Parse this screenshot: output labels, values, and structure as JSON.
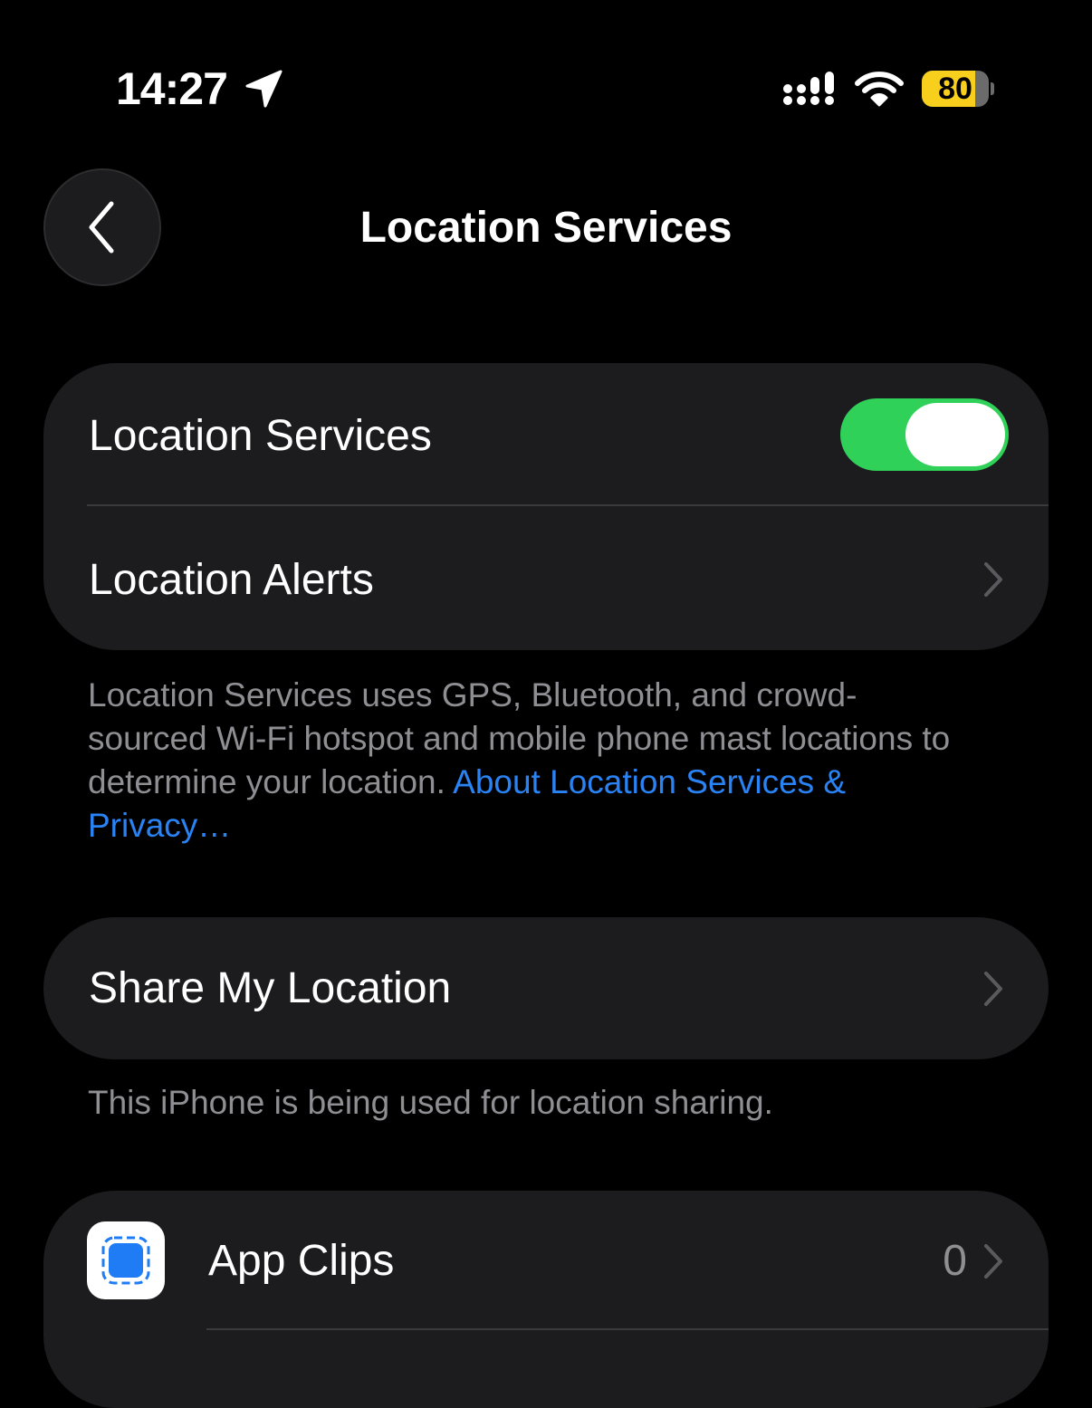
{
  "status_bar": {
    "time": "14:27",
    "battery_level": "80",
    "battery_fraction": 0.8,
    "icons": [
      "location-arrow-icon",
      "cellular-signal-icon",
      "wifi-icon",
      "battery-icon"
    ]
  },
  "nav": {
    "title": "Location Services",
    "back_icon": "chevron-left-icon"
  },
  "location_group": {
    "location_services_label": "Location Services",
    "location_services_enabled": true,
    "location_alerts_label": "Location Alerts"
  },
  "location_footer": {
    "text": "Location Services uses GPS, Bluetooth, and crowd-sourced Wi-Fi hotspot and mobile phone mast locations to determine your location.",
    "link": "About Location Services & Privacy…"
  },
  "share_group": {
    "share_my_location_label": "Share My Location"
  },
  "share_footer": {
    "text": "This iPhone is being used for location sharing."
  },
  "apps_group": {
    "items": [
      {
        "label": "App Clips",
        "value": "0",
        "icon": "app-clips-icon"
      }
    ]
  },
  "colors": {
    "background": "#000000",
    "group_background": "#1c1c1e",
    "toggle_on": "#30d158",
    "link": "#2a83f4",
    "secondary_text": "#8e8e93",
    "battery": "#f7cf1c"
  }
}
